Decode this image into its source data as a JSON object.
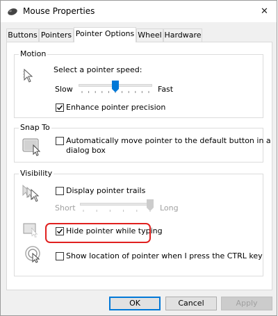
{
  "window": {
    "title": "Mouse Properties",
    "icon": "mouse-icon",
    "close_glyph": "✕"
  },
  "tabs": [
    {
      "label": "Buttons",
      "active": false
    },
    {
      "label": "Pointers",
      "active": false
    },
    {
      "label": "Pointer Options",
      "active": true
    },
    {
      "label": "Wheel",
      "active": false
    },
    {
      "label": "Hardware",
      "active": false
    }
  ],
  "motion": {
    "title": "Motion",
    "prompt": "Select a pointer speed:",
    "slow_label": "Slow",
    "fast_label": "Fast",
    "speed_fraction": 0.5,
    "precision": {
      "label": "Enhance pointer precision",
      "checked": true
    }
  },
  "snap_to": {
    "title": "Snap To",
    "option": {
      "label_line1": "Automatically move pointer to the default button in a",
      "label_line2": "dialog box",
      "checked": false
    }
  },
  "visibility": {
    "title": "Visibility",
    "trails": {
      "label": "Display pointer trails",
      "checked": false
    },
    "short_label": "Short",
    "long_label": "Long",
    "trail_fraction": 1.0,
    "hide_typing": {
      "label": "Hide pointer while typing",
      "checked": true,
      "highlight_color": "#e0201f"
    },
    "show_location": {
      "label": "Show location of pointer when I press the CTRL key",
      "checked": false
    }
  },
  "buttons": {
    "ok": "OK",
    "cancel": "Cancel",
    "apply": "Apply"
  },
  "colors": {
    "accent": "#0078d7",
    "slider_thumb": "#0078d7",
    "highlight": "#e0201f"
  }
}
